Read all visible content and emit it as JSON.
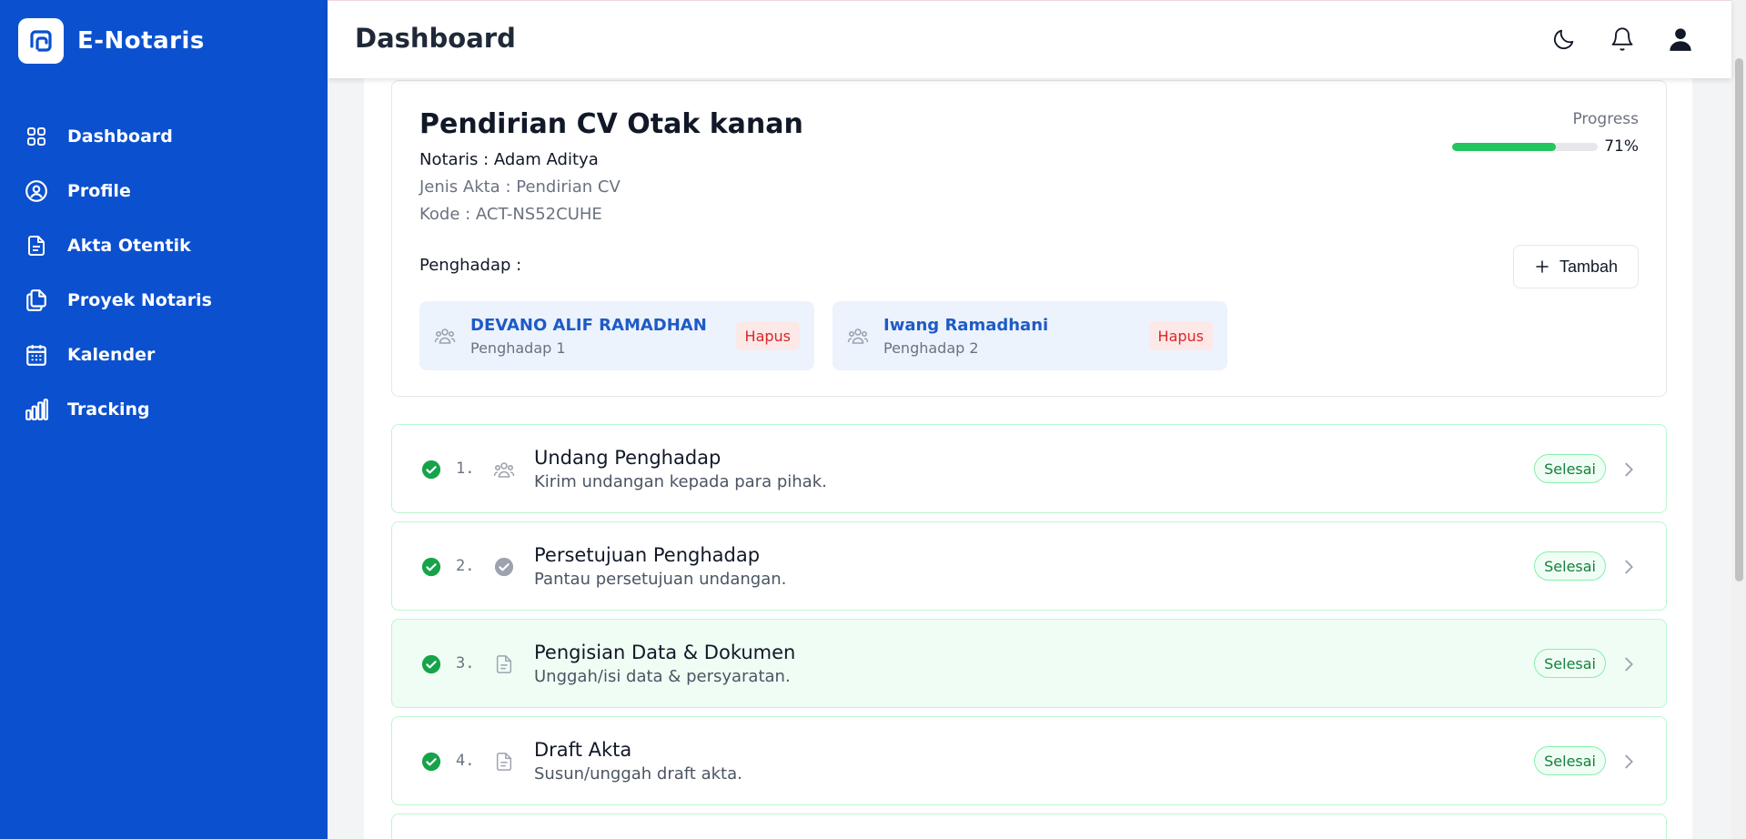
{
  "app": {
    "name": "E-Notaris"
  },
  "sidebar": {
    "items": [
      {
        "label": "Dashboard",
        "icon": "grid-icon"
      },
      {
        "label": "Profile",
        "icon": "user-circle-icon"
      },
      {
        "label": "Akta Otentik",
        "icon": "document-icon"
      },
      {
        "label": "Proyek Notaris",
        "icon": "files-icon"
      },
      {
        "label": "Kalender",
        "icon": "calendar-icon"
      },
      {
        "label": "Tracking",
        "icon": "bar-chart-icon"
      }
    ]
  },
  "header": {
    "title": "Dashboard",
    "icons": [
      "moon-icon",
      "bell-icon",
      "user-icon"
    ]
  },
  "project": {
    "title": "Pendirian CV Otak kanan",
    "notaris": "Notaris : Adam Aditya",
    "jenis": "Jenis Akta : Pendirian CV",
    "kode": "Kode : ACT-NS52CUHE",
    "progress_label": "Progress",
    "progress_value": "71%",
    "progress_fraction": 0.71,
    "penghadap_label": "Penghadap :",
    "tambah_label": "Tambah",
    "penghadap": [
      {
        "name": "DEVANO ALIF RAMADHAN",
        "role": "Penghadap 1",
        "action": "Hapus"
      },
      {
        "name": "Iwang Ramadhani",
        "role": "Penghadap 2",
        "action": "Hapus"
      }
    ]
  },
  "steps": [
    {
      "num": "1.",
      "title": "Undang Penghadap",
      "desc": "Kirim undangan kepada para pihak.",
      "status": "Selesai",
      "icon": "users-icon"
    },
    {
      "num": "2.",
      "title": "Persetujuan Penghadap",
      "desc": "Pantau persetujuan undangan.",
      "status": "Selesai",
      "icon": "check-circle-icon"
    },
    {
      "num": "3.",
      "title": "Pengisian Data & Dokumen",
      "desc": "Unggah/isi data & persyaratan.",
      "status": "Selesai",
      "icon": "document-icon"
    },
    {
      "num": "4.",
      "title": "Draft Akta",
      "desc": "Susun/unggah draft akta.",
      "status": "Selesai",
      "icon": "document-icon"
    }
  ],
  "colors": {
    "sidebar": "#0b50cf",
    "success": "#16a34a",
    "danger": "#dc2626",
    "link": "#1e5bc6"
  }
}
